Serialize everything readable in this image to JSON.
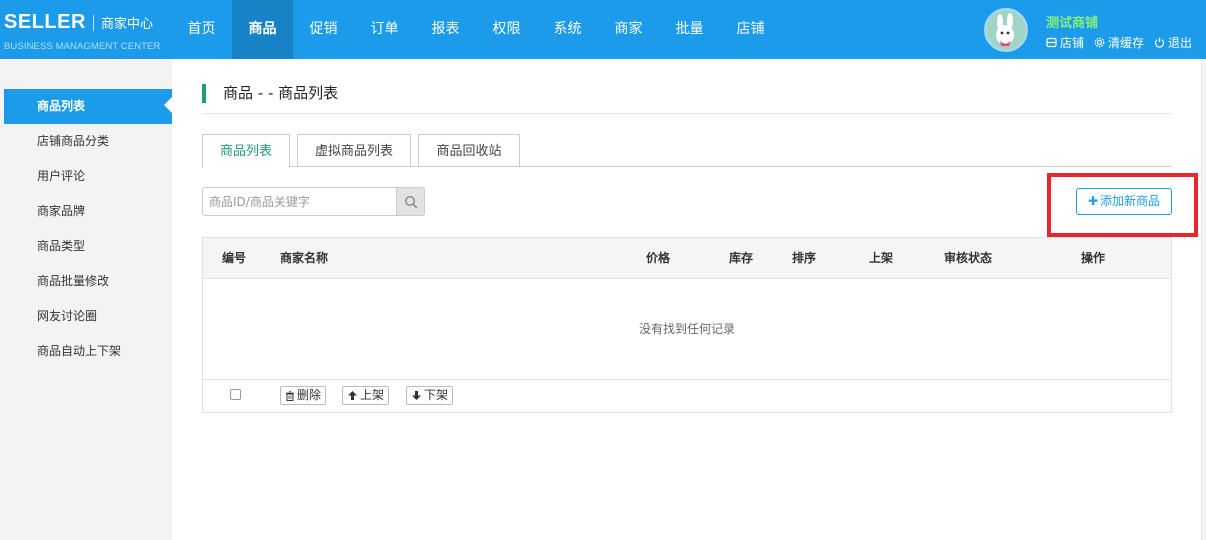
{
  "header": {
    "logo": "SELLER",
    "center_title": "商家中心",
    "subtitle": "BUSINESS MANAGMENT CENTER",
    "nav": [
      "首页",
      "商品",
      "促销",
      "订单",
      "报表",
      "权限",
      "系统",
      "商家",
      "批量",
      "店铺"
    ],
    "active_nav": "商品",
    "shop_name": "测试商铺",
    "links": {
      "store": "店铺",
      "clear_cache": "清缓存",
      "logout": "退出"
    },
    "colors": {
      "bar": "#1b9bea",
      "active": "#1782c6",
      "shop_name": "#7ff07f"
    }
  },
  "sidebar": {
    "items": [
      "商品列表",
      "店铺商品分类",
      "用户评论",
      "商家品牌",
      "商品类型",
      "商品批量修改",
      "网友讨论圈",
      "商品自动上下架"
    ],
    "active": "商品列表"
  },
  "main": {
    "page_title": "商品 - - 商品列表",
    "tabs": [
      "商品列表",
      "虚拟商品列表",
      "商品回收站"
    ],
    "active_tab": "商品列表",
    "search": {
      "placeholder": "商品ID/商品关键字",
      "value": ""
    },
    "add_button": "添加新商品",
    "table": {
      "columns": [
        "编号",
        "商家名称",
        "价格",
        "库存",
        "排序",
        "上架",
        "审核状态",
        "操作"
      ],
      "rows": [],
      "empty_text": "没有找到任何记录"
    },
    "bulk_actions": {
      "delete": "删除",
      "up": "上架",
      "down": "下架"
    }
  }
}
